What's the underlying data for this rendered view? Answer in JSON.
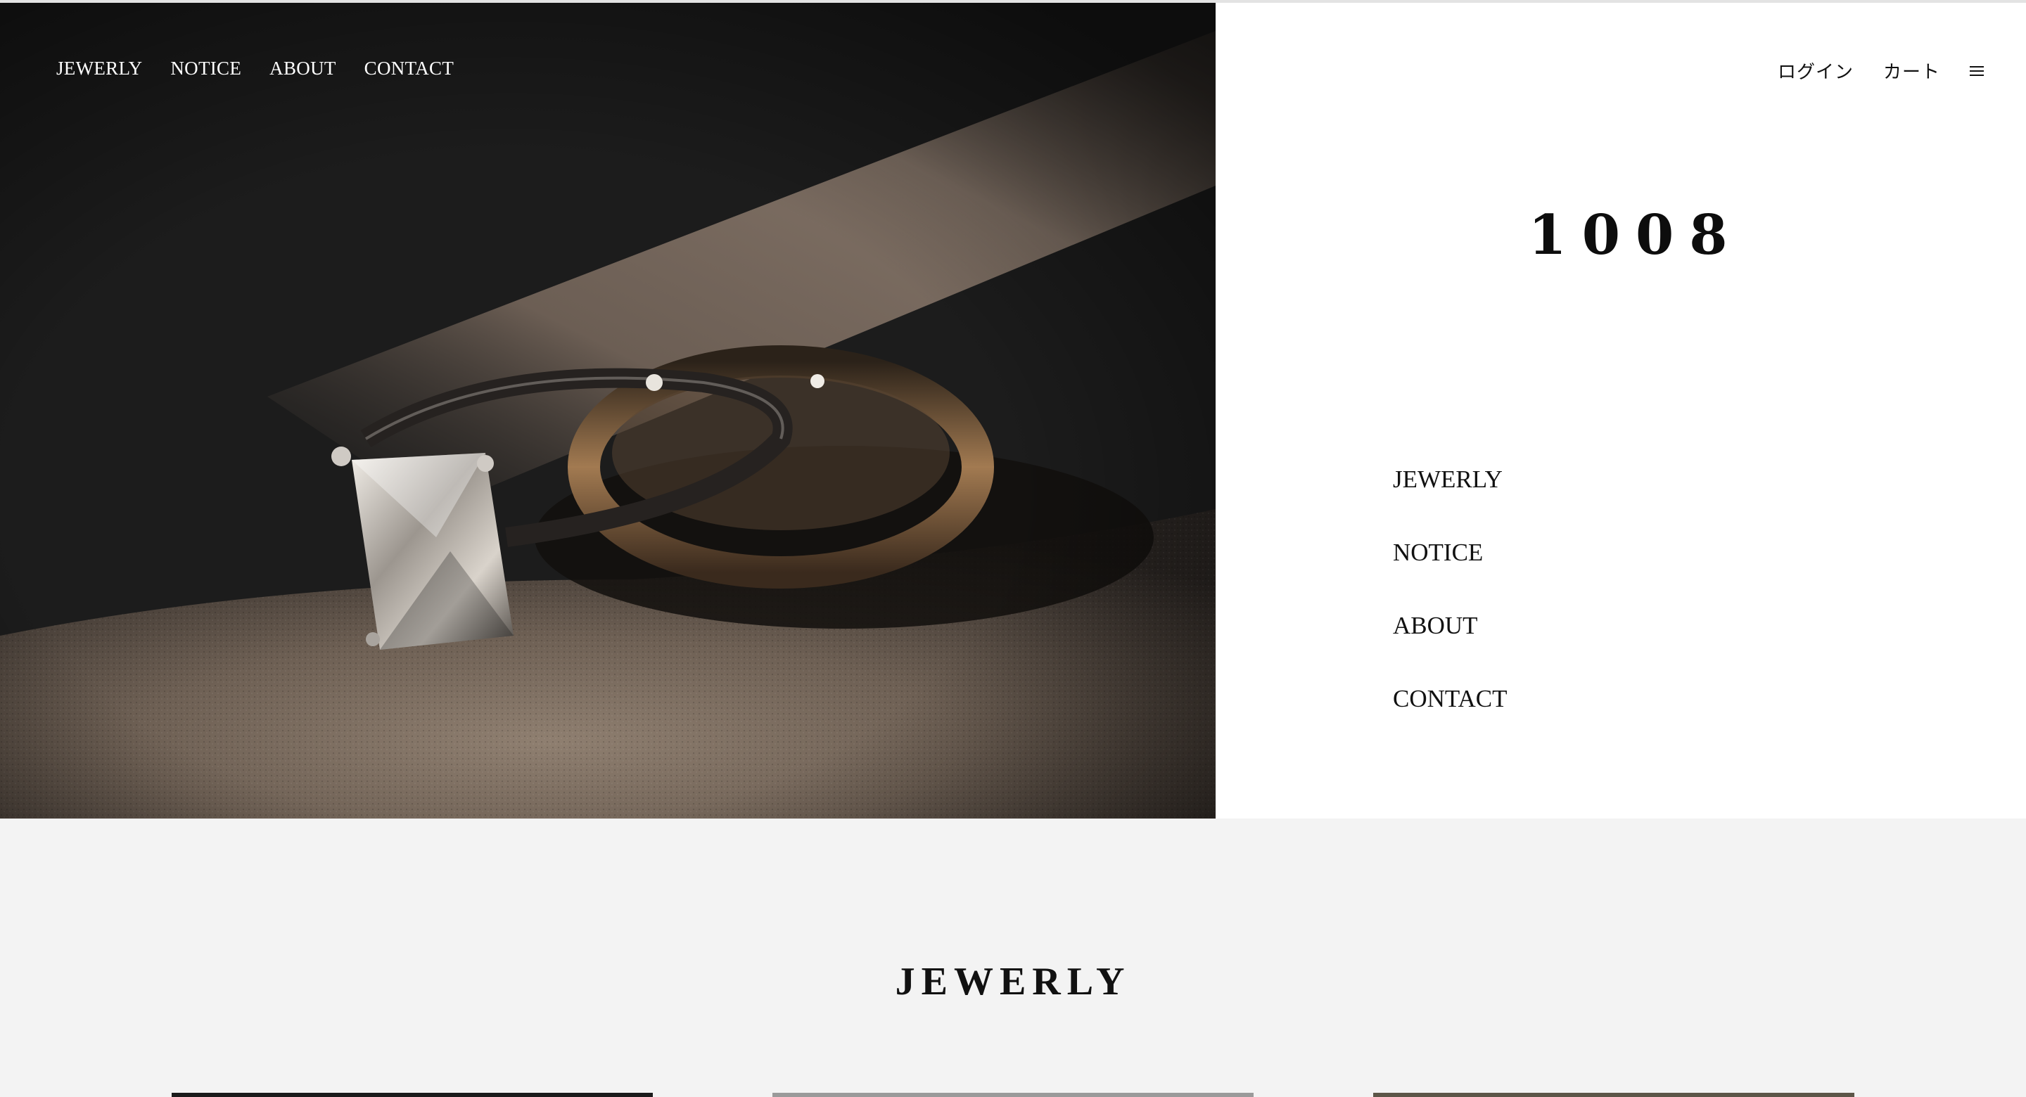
{
  "hero": {
    "image_alt": "Princess cut diamond ring and band on textured stone",
    "left_nav": [
      "JEWERLY",
      "NOTICE",
      "ABOUT",
      "CONTACT"
    ]
  },
  "header": {
    "login_label": "ログイン",
    "cart_label": "カート",
    "menu_icon": "hamburger-menu-icon"
  },
  "brand": {
    "name": "1008"
  },
  "panel_nav": [
    "JEWERLY",
    "NOTICE",
    "ABOUT",
    "CONTACT"
  ],
  "section": {
    "title": "JEWERLY"
  },
  "colors": {
    "hero_dark": "#1f1f1f",
    "section_bg": "#f3f3f3",
    "text": "#111111"
  }
}
